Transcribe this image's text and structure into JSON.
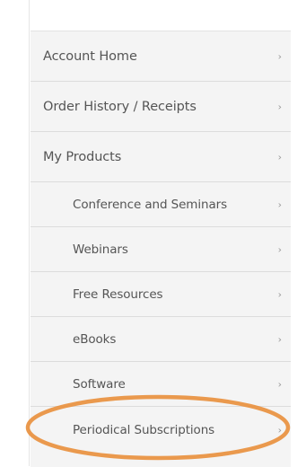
{
  "sidebar": {
    "items": [
      {
        "label": "Account Home",
        "level": 1,
        "chevron": "›"
      },
      {
        "label": "Order History / Receipts",
        "level": 1,
        "chevron": "›"
      },
      {
        "label": "My Products",
        "level": 1,
        "chevron": "›"
      },
      {
        "label": "Conference and Seminars",
        "level": 2,
        "chevron": "›"
      },
      {
        "label": "Webinars",
        "level": 2,
        "chevron": "›"
      },
      {
        "label": "Free Resources",
        "level": 2,
        "chevron": "›"
      },
      {
        "label": "eBooks",
        "level": 2,
        "chevron": "›"
      },
      {
        "label": "Software",
        "level": 2,
        "chevron": "›"
      },
      {
        "label": "Periodical Subscriptions",
        "level": 2,
        "chevron": "›"
      }
    ]
  },
  "highlight": {
    "target": "Periodical Subscriptions",
    "color": "#e8903e"
  },
  "colors": {
    "background": "#f4f4f4",
    "text": "#555555",
    "divider": "#dcdcdc"
  }
}
